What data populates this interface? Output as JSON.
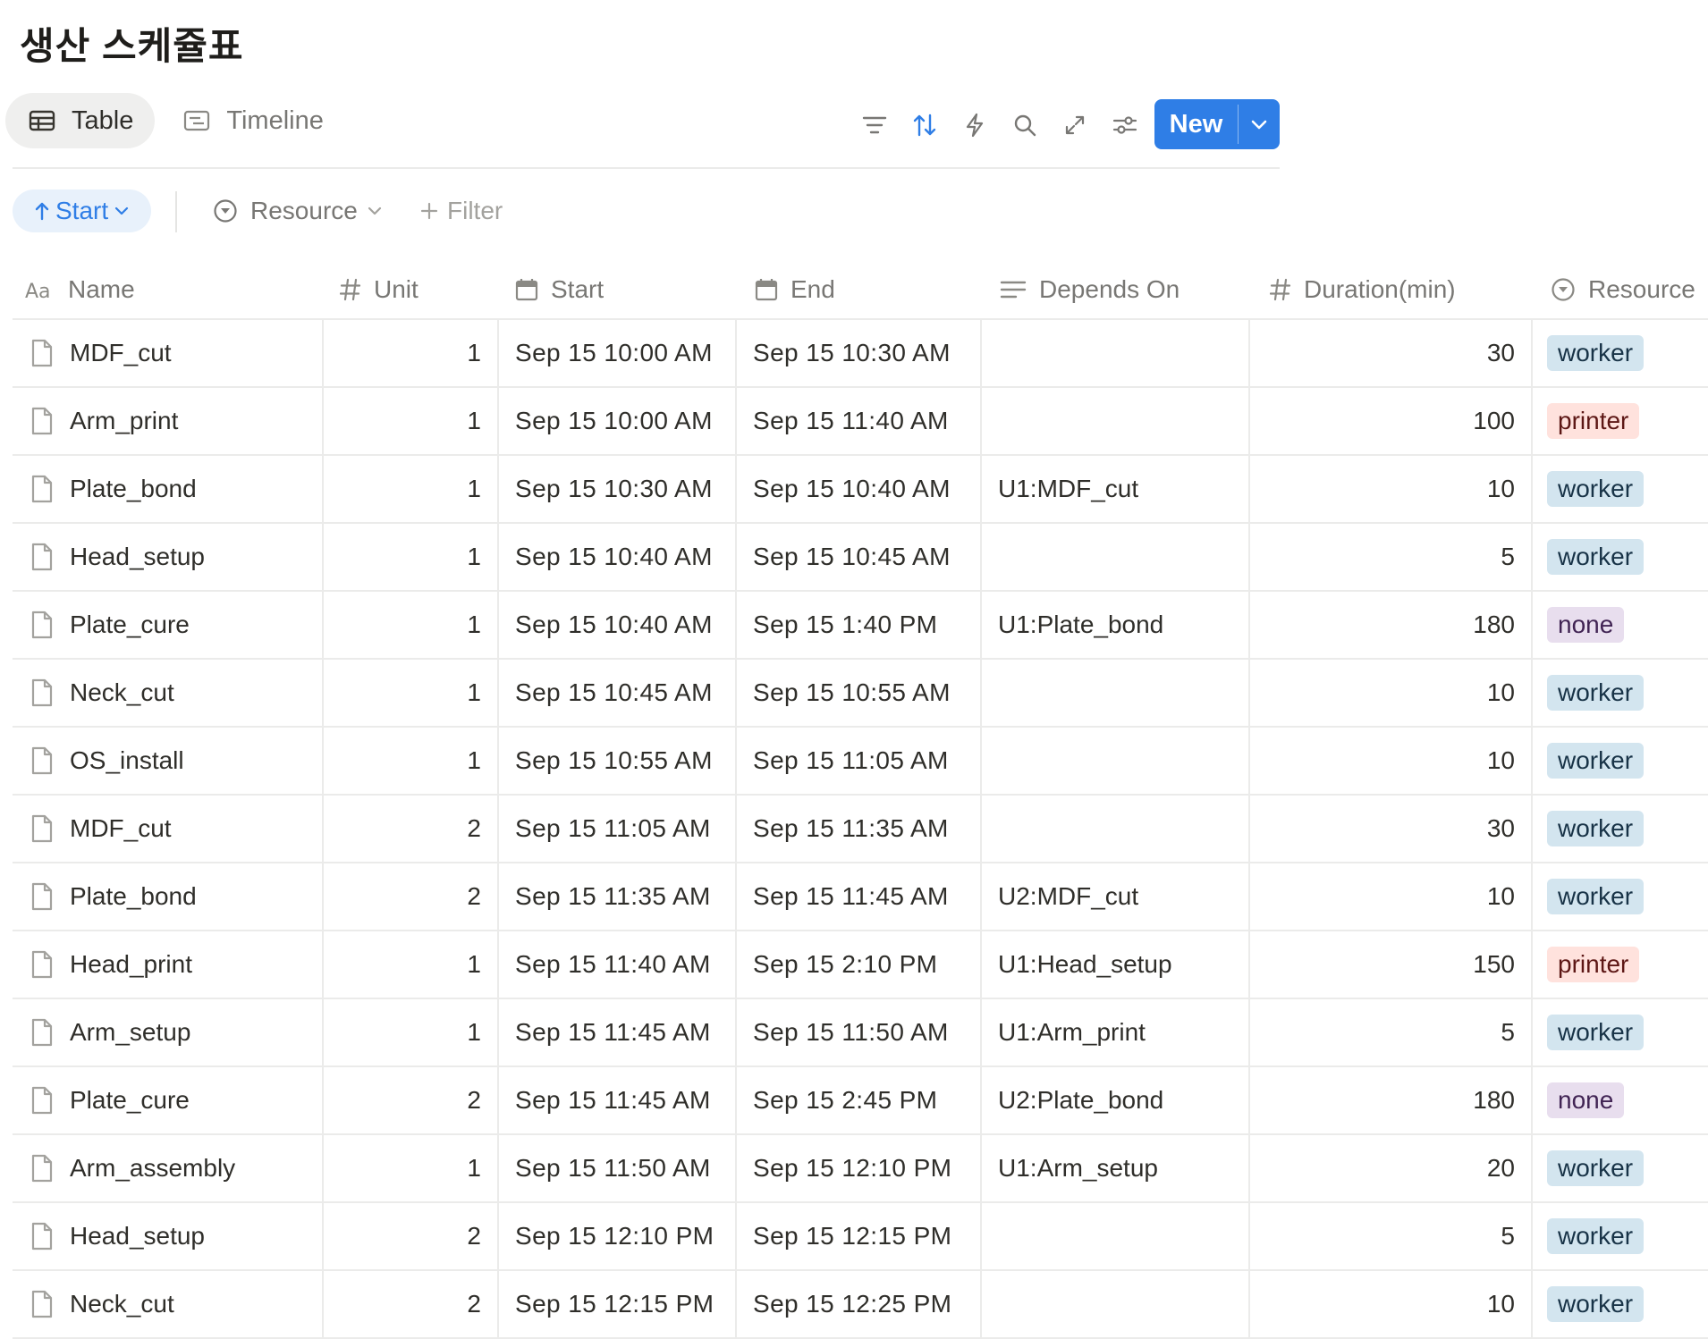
{
  "page": {
    "title": "생산 스케쥴표"
  },
  "views": [
    {
      "label": "Table",
      "active": true
    },
    {
      "label": "Timeline",
      "active": false
    }
  ],
  "toolbar": {
    "new_label": "New"
  },
  "filters": {
    "sort_label": "Start",
    "property_label": "Resource",
    "add_filter_label": "Filter"
  },
  "columns": [
    {
      "label": "Name",
      "icon": "title-icon"
    },
    {
      "label": "Unit",
      "icon": "number-icon"
    },
    {
      "label": "Start",
      "icon": "calendar-icon"
    },
    {
      "label": "End",
      "icon": "calendar-icon"
    },
    {
      "label": "Depends On",
      "icon": "text-icon"
    },
    {
      "label": "Duration(min)",
      "icon": "number-icon"
    },
    {
      "label": "Resource",
      "icon": "select-icon"
    }
  ],
  "tag_colors": {
    "worker": {
      "bg": "#d3e5ef",
      "fg": "#183347"
    },
    "printer": {
      "bg": "#ffe2dd",
      "fg": "#5d1715"
    },
    "none": {
      "bg": "#e8deee",
      "fg": "#412454"
    }
  },
  "rows": [
    {
      "name": "MDF_cut",
      "unit": "1",
      "start": "Sep 15 10:00 AM",
      "end": "Sep 15 10:30 AM",
      "depends": "",
      "duration": "30",
      "resource": "worker"
    },
    {
      "name": "Arm_print",
      "unit": "1",
      "start": "Sep 15 10:00 AM",
      "end": "Sep 15 11:40 AM",
      "depends": "",
      "duration": "100",
      "resource": "printer"
    },
    {
      "name": "Plate_bond",
      "unit": "1",
      "start": "Sep 15 10:30 AM",
      "end": "Sep 15 10:40 AM",
      "depends": "U1:MDF_cut",
      "duration": "10",
      "resource": "worker"
    },
    {
      "name": "Head_setup",
      "unit": "1",
      "start": "Sep 15 10:40 AM",
      "end": "Sep 15 10:45 AM",
      "depends": "",
      "duration": "5",
      "resource": "worker"
    },
    {
      "name": "Plate_cure",
      "unit": "1",
      "start": "Sep 15 10:40 AM",
      "end": "Sep 15 1:40 PM",
      "depends": "U1:Plate_bond",
      "duration": "180",
      "resource": "none"
    },
    {
      "name": "Neck_cut",
      "unit": "1",
      "start": "Sep 15 10:45 AM",
      "end": "Sep 15 10:55 AM",
      "depends": "",
      "duration": "10",
      "resource": "worker"
    },
    {
      "name": "OS_install",
      "unit": "1",
      "start": "Sep 15 10:55 AM",
      "end": "Sep 15 11:05 AM",
      "depends": "",
      "duration": "10",
      "resource": "worker"
    },
    {
      "name": "MDF_cut",
      "unit": "2",
      "start": "Sep 15 11:05 AM",
      "end": "Sep 15 11:35 AM",
      "depends": "",
      "duration": "30",
      "resource": "worker"
    },
    {
      "name": "Plate_bond",
      "unit": "2",
      "start": "Sep 15 11:35 AM",
      "end": "Sep 15 11:45 AM",
      "depends": "U2:MDF_cut",
      "duration": "10",
      "resource": "worker"
    },
    {
      "name": "Head_print",
      "unit": "1",
      "start": "Sep 15 11:40 AM",
      "end": "Sep 15 2:10 PM",
      "depends": "U1:Head_setup",
      "duration": "150",
      "resource": "printer"
    },
    {
      "name": "Arm_setup",
      "unit": "1",
      "start": "Sep 15 11:45 AM",
      "end": "Sep 15 11:50 AM",
      "depends": "U1:Arm_print",
      "duration": "5",
      "resource": "worker"
    },
    {
      "name": "Plate_cure",
      "unit": "2",
      "start": "Sep 15 11:45 AM",
      "end": "Sep 15 2:45 PM",
      "depends": "U2:Plate_bond",
      "duration": "180",
      "resource": "none"
    },
    {
      "name": "Arm_assembly",
      "unit": "1",
      "start": "Sep 15 11:50 AM",
      "end": "Sep 15 12:10 PM",
      "depends": "U1:Arm_setup",
      "duration": "20",
      "resource": "worker"
    },
    {
      "name": "Head_setup",
      "unit": "2",
      "start": "Sep 15 12:10 PM",
      "end": "Sep 15 12:15 PM",
      "depends": "",
      "duration": "5",
      "resource": "worker"
    },
    {
      "name": "Neck_cut",
      "unit": "2",
      "start": "Sep 15 12:15 PM",
      "end": "Sep 15 12:25 PM",
      "depends": "",
      "duration": "10",
      "resource": "worker"
    }
  ]
}
